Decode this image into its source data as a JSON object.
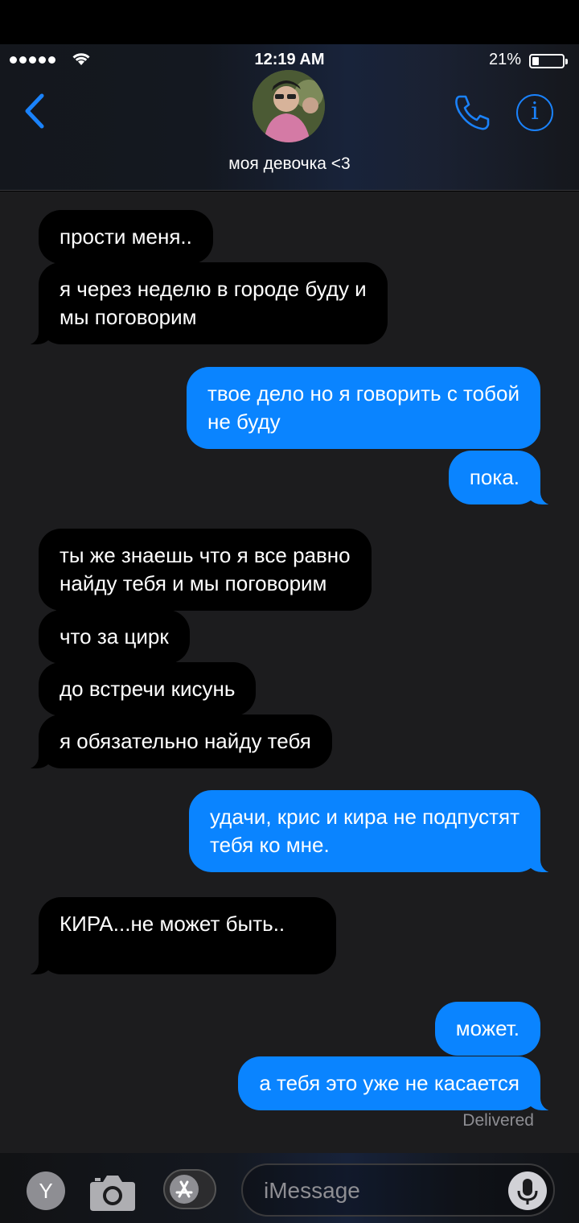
{
  "status_bar": {
    "time": "12:19 AM",
    "battery_percent": "21%",
    "battery_level": 0.21
  },
  "header": {
    "contact_name": "моя девочка <3",
    "back_icon": "chevron-left-icon",
    "call_icon": "phone-icon",
    "info_icon": "info-icon"
  },
  "messages": [
    {
      "direction": "incoming",
      "text": "прости меня.."
    },
    {
      "direction": "incoming",
      "text": "я через неделю в городе буду и\nмы поговорим"
    },
    {
      "direction": "outgoing",
      "text": "твое дело но я говорить с тобой\nне буду"
    },
    {
      "direction": "outgoing",
      "text": "пока."
    },
    {
      "direction": "incoming",
      "text": "ты же знаешь что я все равно\nнайду тебя и мы поговорим"
    },
    {
      "direction": "incoming",
      "text": "что за цирк"
    },
    {
      "direction": "incoming",
      "text": "до встречи кисунь"
    },
    {
      "direction": "incoming",
      "text": "я обязательно найду тебя"
    },
    {
      "direction": "outgoing",
      "text": "удачи, крис и кира не подпустят\nтебя ко мне."
    },
    {
      "direction": "incoming",
      "text": "КИРА...не может быть..\n"
    },
    {
      "direction": "outgoing",
      "text": "может."
    },
    {
      "direction": "outgoing",
      "text": "а тебя это уже не касается"
    }
  ],
  "delivery_status": "Delivered",
  "input_bar": {
    "profile_initial": "Y",
    "placeholder": "iMessage",
    "icons": [
      "camera-icon",
      "app-store-icon",
      "microphone-icon"
    ]
  },
  "colors": {
    "outgoing_bubble": "#0a84ff",
    "incoming_bubble": "#000000",
    "accent": "#1a82fb",
    "chat_background": "#1c1c1e"
  }
}
